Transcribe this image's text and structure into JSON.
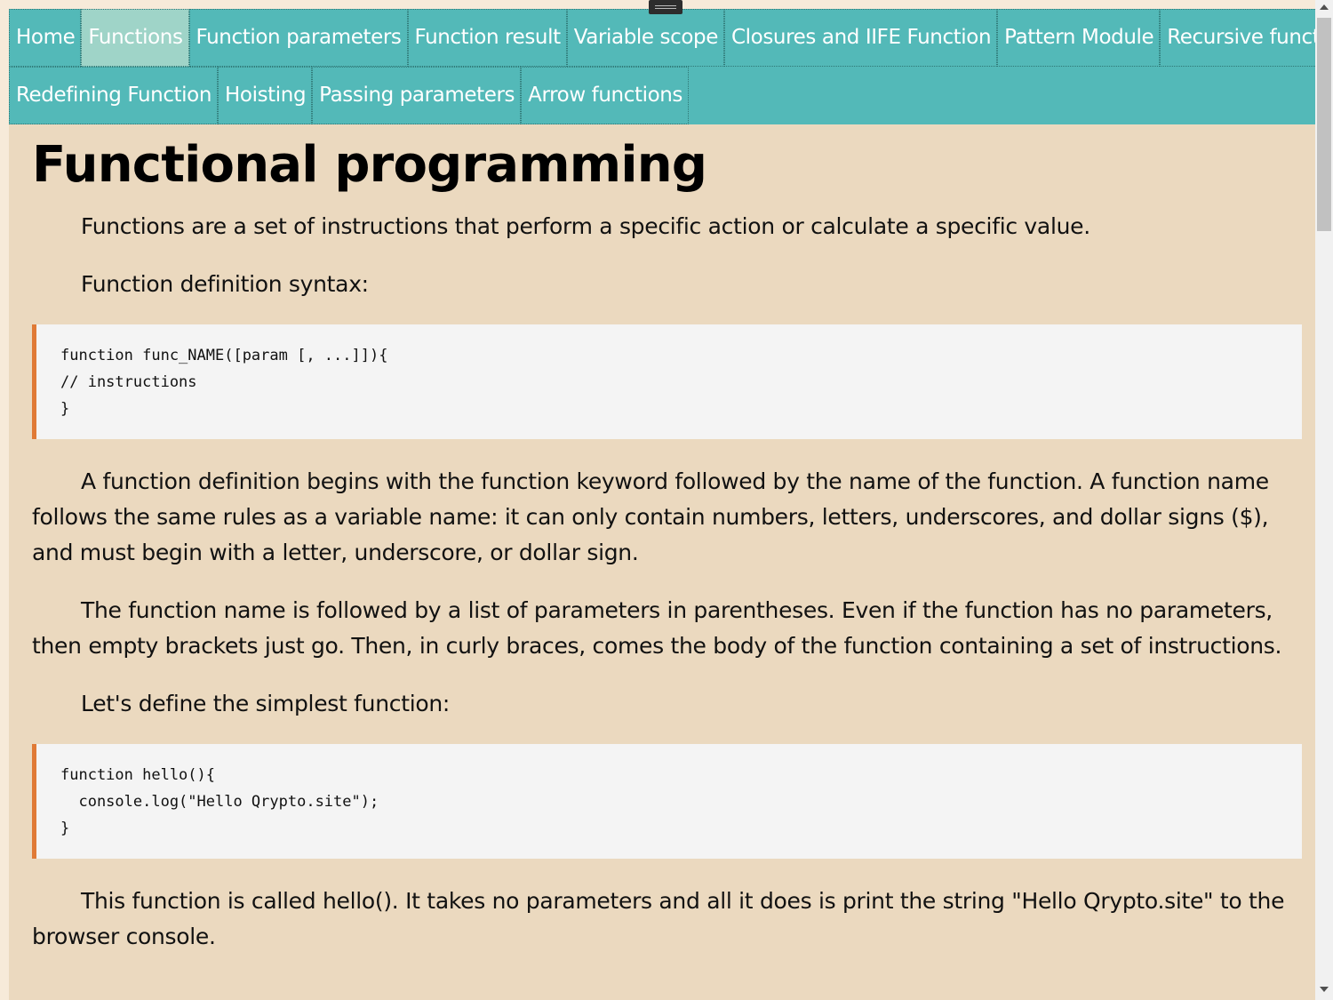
{
  "nav": {
    "row1": [
      {
        "label": "Home",
        "active": false
      },
      {
        "label": "Functions",
        "active": true
      },
      {
        "label": "Function parameters",
        "active": false
      },
      {
        "label": "Function result",
        "active": false
      },
      {
        "label": "Variable scope",
        "active": false
      },
      {
        "label": "Closures and IIFE Function",
        "active": false
      },
      {
        "label": "Pattern Module",
        "active": false
      },
      {
        "label": "Recursive function",
        "active": false
      }
    ],
    "row2": [
      {
        "label": "Redefining Function",
        "active": false
      },
      {
        "label": "Hoisting",
        "active": false
      },
      {
        "label": "Passing parameters",
        "active": false
      },
      {
        "label": "Arrow functions",
        "active": false
      }
    ]
  },
  "content": {
    "title": "Functional programming",
    "p1": "Functions are a set of instructions that perform a specific action or calculate a specific value.",
    "p2": "Function definition syntax:",
    "code1": "function func_NAME([param [, ...]]){\n// instructions\n}",
    "p3": "A function definition begins with the function keyword followed by the name of the function. A function name follows the same rules as a variable name: it can only contain numbers, letters, underscores, and dollar signs ($), and must begin with a letter, underscore, or dollar sign.",
    "p4": "The function name is followed by a list of parameters in parentheses. Even if the function has no parameters, then empty brackets just go. Then, in curly braces, comes the body of the function containing a set of instructions.",
    "p5": "Let's define the simplest function:",
    "code2": "function hello(){\n  console.log(\"Hello Qrypto.site\");\n}",
    "p6": "This function is called hello(). It takes no parameters and all it does is print the string \"Hello Qrypto.site\" to the browser console."
  },
  "colors": {
    "nav_bg": "#53b9b8",
    "nav_active": "#9fd4c8",
    "page_bg": "#ebd9bf",
    "code_border": "#e07a36"
  }
}
